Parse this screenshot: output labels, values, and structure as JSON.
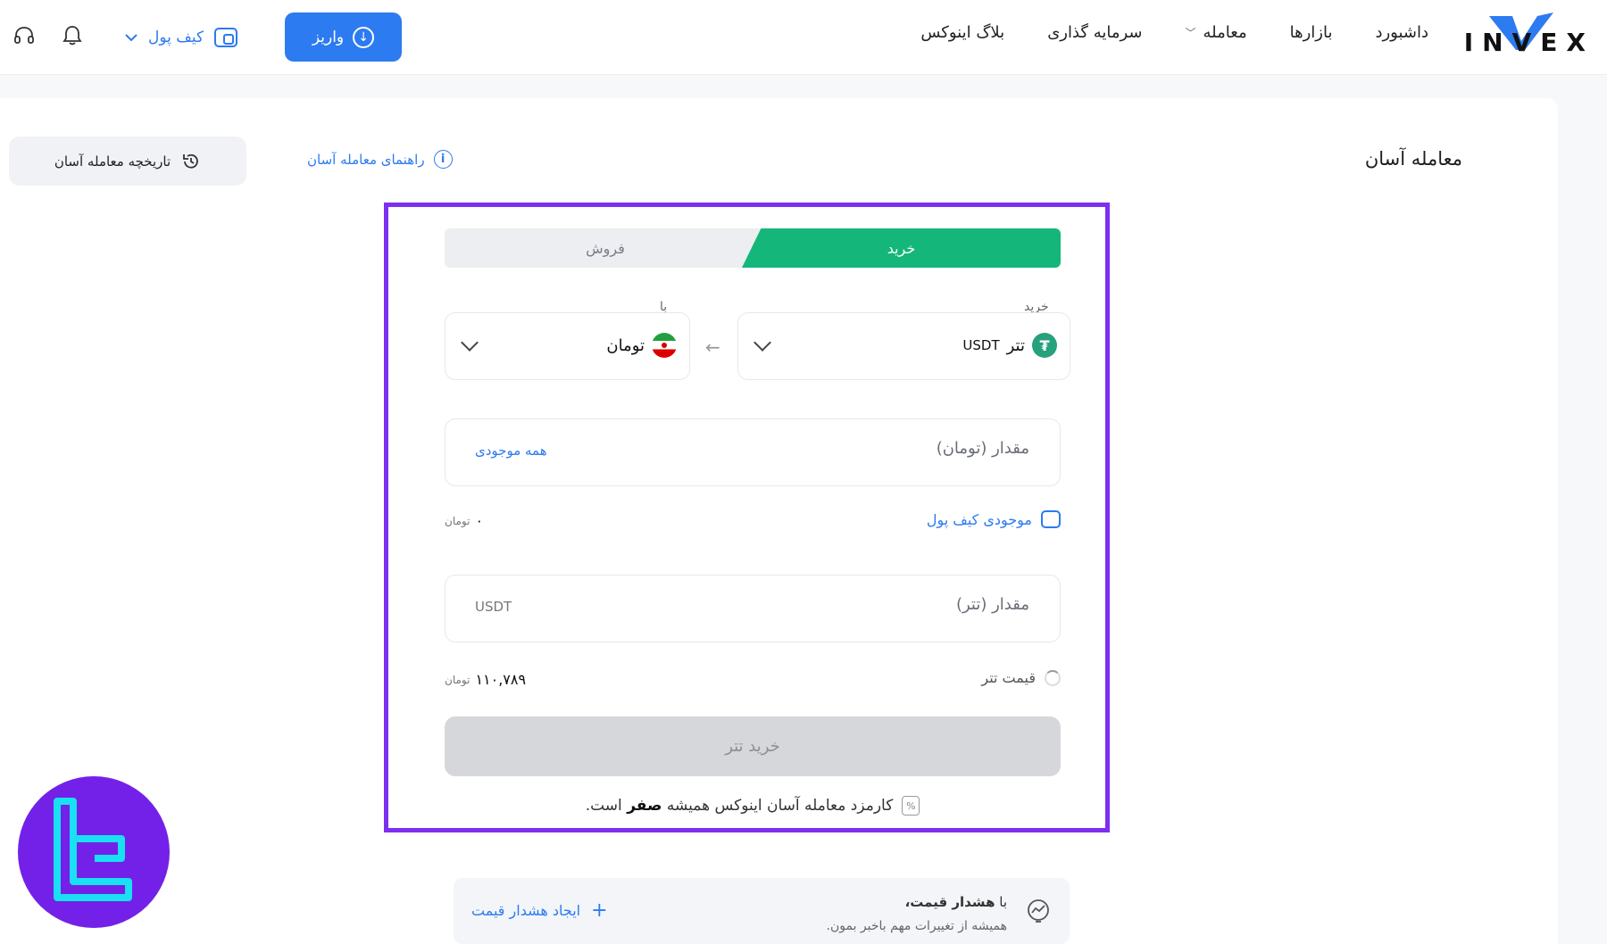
{
  "header": {
    "logo_text": "INVEX",
    "nav": [
      "داشبورد",
      "بازارها",
      "معامله",
      "سرمایه گذاری",
      "بلاگ اینوکس"
    ],
    "deposit_label": "واریز",
    "wallet_label": "کیف پول"
  },
  "page": {
    "title": "معامله آسان",
    "guide_label": "راهنمای معامله آسان",
    "history_label": "تاریخچه معامله آسان"
  },
  "trade": {
    "tab_buy": "خرید",
    "tab_sell": "فروش",
    "buy_label": "خرید",
    "with_label": "با",
    "buy_asset_name": "تتر",
    "buy_asset_symbol": "USDT",
    "pay_asset_name": "تومان",
    "amount_toman_label": "مقدار (تومان)",
    "all_balance_label": "همه موجودی",
    "wallet_balance_label": "موجودی کیف پول",
    "wallet_balance_value": "۰",
    "wallet_balance_unit": "تومان",
    "amount_usdt_label": "مقدار (تتر)",
    "amount_usdt_unit": "USDT",
    "price_label": "قیمت تتر",
    "price_value": "۱۱۰,۷۸۹",
    "price_unit": "تومان",
    "submit_label": "خرید تتر",
    "fee_note_prefix": "کارمزد معامله آسان اینوکس همیشه",
    "fee_note_bold": "صفر",
    "fee_note_suffix": "است."
  },
  "alert": {
    "line1_prefix": "با",
    "line1_bold": "هشدار قیمت،",
    "line2": "همیشه از تغییرات مهم باخبر بمون.",
    "create_label": "ایجاد هشدار قیمت"
  },
  "colors": {
    "primary": "#2c7bf0",
    "buy_green": "#14b779",
    "frame_purple": "#7c2ff0",
    "badge_purple": "#7321e8",
    "badge_accent": "#19e0f2"
  }
}
